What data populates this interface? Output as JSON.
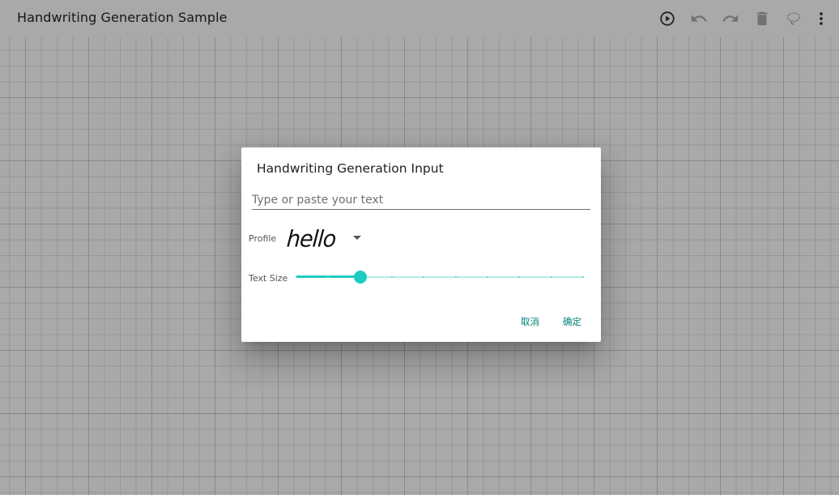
{
  "toolbar": {
    "title": "Handwriting Generation Sample",
    "actions": [
      {
        "icon": "play-circle-icon",
        "enabled": true
      },
      {
        "icon": "undo-icon",
        "enabled": false
      },
      {
        "icon": "redo-icon",
        "enabled": false
      },
      {
        "icon": "trash-icon",
        "enabled": false
      },
      {
        "icon": "lasso-icon",
        "enabled": false
      },
      {
        "icon": "more-vertical-icon",
        "enabled": true
      }
    ]
  },
  "dialog": {
    "title": "Handwriting Generation Input",
    "input": {
      "value": "",
      "placeholder": "Type or paste your text"
    },
    "profile": {
      "label": "Profile",
      "selected_preview": "hello"
    },
    "text_size": {
      "label": "Text Size",
      "value": 2,
      "min": 0,
      "max": 9
    },
    "buttons": {
      "cancel": "取消",
      "confirm": "确定"
    }
  },
  "colors": {
    "accent": "#1bccc0",
    "accent_track": "#b2efe9",
    "button_text": "#00857a",
    "enabled_icon": "#333333",
    "disabled_icon": "#a8a8a8"
  }
}
